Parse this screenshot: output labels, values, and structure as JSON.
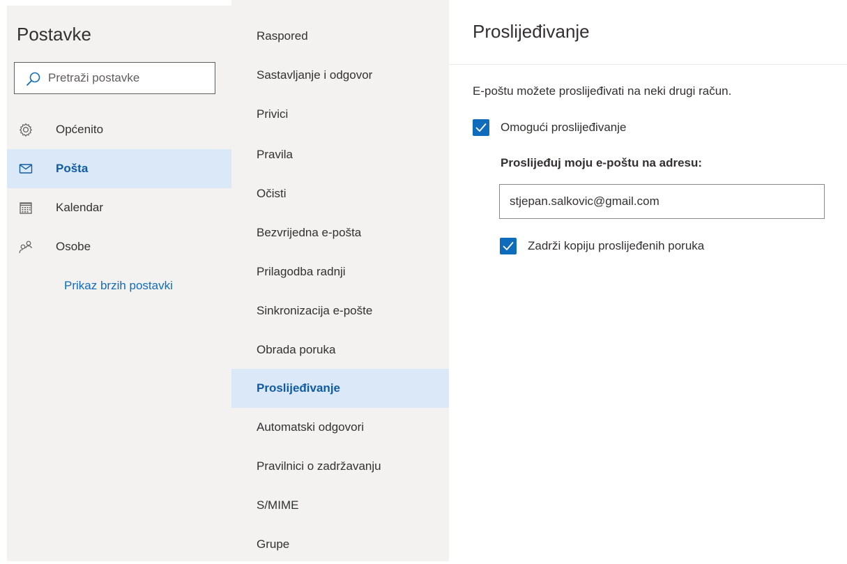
{
  "sidebar": {
    "title": "Postavke",
    "search": {
      "placeholder": "Pretraži postavke",
      "icon": "search-icon"
    },
    "items": [
      {
        "label": "Općenito",
        "icon": "gear-icon",
        "selected": false
      },
      {
        "label": "Pošta",
        "icon": "mail-icon",
        "selected": true
      },
      {
        "label": "Kalendar",
        "icon": "calendar-icon",
        "selected": false
      },
      {
        "label": "Osobe",
        "icon": "people-icon",
        "selected": false
      }
    ],
    "quick_settings_link": "Prikaz brzih postavki"
  },
  "categories": [
    {
      "label": "Raspored",
      "selected": false
    },
    {
      "label": "Sastavljanje i odgovor",
      "selected": false
    },
    {
      "label": "Privici",
      "selected": false
    },
    {
      "label": "Pravila",
      "selected": false
    },
    {
      "label": "Očisti",
      "selected": false
    },
    {
      "label": "Bezvrijedna e-pošta",
      "selected": false
    },
    {
      "label": "Prilagodba radnji",
      "selected": false
    },
    {
      "label": "Sinkronizacija e-pošte",
      "selected": false
    },
    {
      "label": "Obrada poruka",
      "selected": false
    },
    {
      "label": "Proslijeđivanje",
      "selected": true
    },
    {
      "label": "Automatski odgovori",
      "selected": false
    },
    {
      "label": "Pravilnici o zadržavanju",
      "selected": false
    },
    {
      "label": "S/MIME",
      "selected": false
    },
    {
      "label": "Grupe",
      "selected": false
    }
  ],
  "panel": {
    "title": "Proslijeđivanje",
    "description": "E-poštu možete proslijeđivati na neki drugi račun.",
    "enable_forwarding": {
      "label": "Omogući proslijeđivanje",
      "checked": true
    },
    "forward_to_label": "Proslijeđuj moju e-poštu na adresu:",
    "forward_to_value": "stjepan.salkovic@gmail.com",
    "keep_copy": {
      "label": "Zadrži kopiju proslijeđenih poruka",
      "checked": true
    }
  },
  "colors": {
    "accent": "#0f6cbd",
    "selected_bg": "#dbe8f7",
    "pane_bg": "#f3f2f1",
    "selected_text": "#0f5ba5"
  }
}
